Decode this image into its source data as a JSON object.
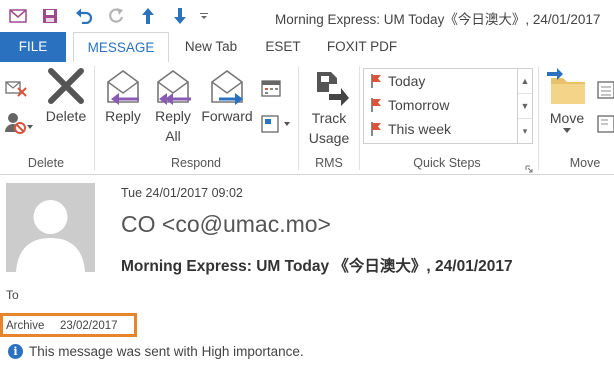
{
  "window": {
    "title": "Morning Express: UM Today《今日澳大》, 24/01/2017"
  },
  "tabs": [
    {
      "label": "FILE"
    },
    {
      "label": "MESSAGE"
    },
    {
      "label": "New Tab"
    },
    {
      "label": "ESET"
    },
    {
      "label": "FOXIT PDF"
    }
  ],
  "ribbon": {
    "delete_group": {
      "delete_label": "Delete",
      "group_label": "Delete"
    },
    "respond_group": {
      "reply_label": "Reply",
      "reply_all_line1": "Reply",
      "reply_all_line2": "All",
      "forward_label": "Forward",
      "group_label": "Respond"
    },
    "rms_group": {
      "track_line1": "Track",
      "track_line2": "Usage",
      "group_label": "RMS"
    },
    "quick_steps": {
      "items": [
        "Today",
        "Tomorrow",
        "This week"
      ],
      "group_label": "Quick Steps"
    },
    "move_group": {
      "move_label": "Move",
      "group_label": "Move"
    }
  },
  "message": {
    "date": "Tue 24/01/2017 09:02",
    "from": "CO <co@umac.mo>",
    "subject": "Morning Express: UM Today 《今日澳大》, 24/01/2017",
    "to_label": "To",
    "archive_label": "Archive",
    "archive_date": "23/02/2017",
    "info": "This message was sent with High importance."
  },
  "colors": {
    "accent": "#2a72c0",
    "highlight": "#e8842c",
    "flag": "#d9553c",
    "arrow_purple": "#8a5bb4"
  }
}
